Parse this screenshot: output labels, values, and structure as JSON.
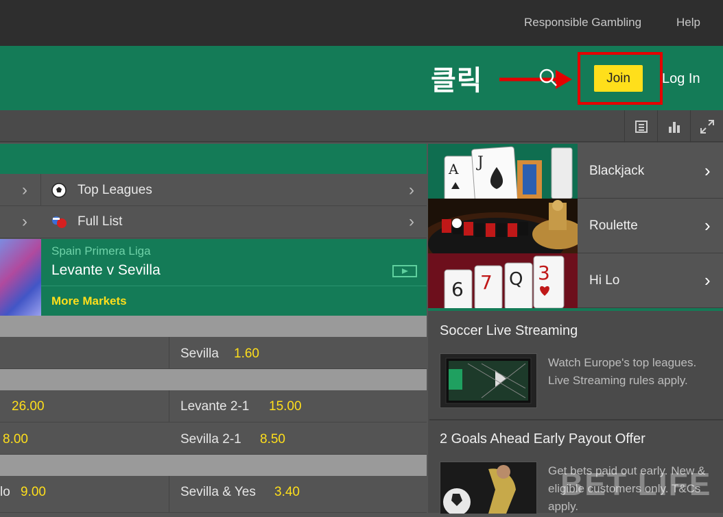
{
  "topbar": {
    "responsible": "Responsible Gambling",
    "help": "Help"
  },
  "header": {
    "annotation": "클릭",
    "join_label": "Join",
    "login_label": "Log In"
  },
  "menu": [
    {
      "label": "Top Leagues",
      "icon": "soccer-ball-icon"
    },
    {
      "label": "Full List",
      "icon": "flags-icon"
    }
  ],
  "event": {
    "league": "Spain Primera Liga",
    "match": "Levante v Sevilla",
    "more": "More Markets"
  },
  "odds": {
    "row1": {
      "right_label": "Sevilla",
      "right_val": "1.60"
    },
    "row2": {
      "left_val": "26.00",
      "right_label": "Levante 2-1",
      "right_val": "15.00"
    },
    "row3": {
      "left_val": "8.00",
      "right_label": "Sevilla 2-1",
      "right_val": "8.50"
    },
    "row4": {
      "left_label": "lo",
      "left_val": "9.00",
      "right_label": "Sevilla & Yes",
      "right_val": "3.40"
    }
  },
  "games": [
    {
      "label": "Blackjack"
    },
    {
      "label": "Roulette"
    },
    {
      "label": "Hi Lo"
    }
  ],
  "promos": [
    {
      "title": "Soccer Live Streaming",
      "text": "Watch Europe's top leagues. Live Streaming rules apply."
    },
    {
      "title": "2 Goals Ahead Early Payout Offer",
      "text": "Get bets paid out early. New & eligible customers only. T&Cs apply."
    }
  ],
  "watermark": "BET LIFE",
  "colors": {
    "brand_green": "#147b57",
    "join_yellow": "#ffdf1b",
    "highlight_red": "#e40000"
  }
}
